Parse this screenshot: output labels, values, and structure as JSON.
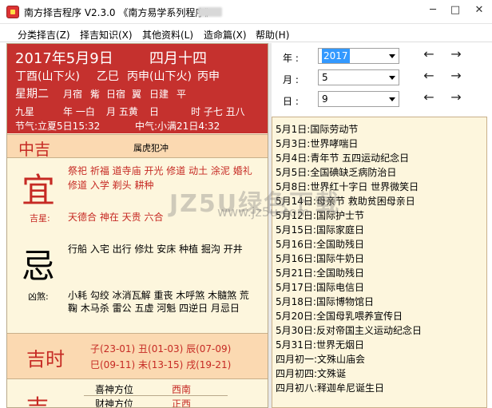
{
  "window": {
    "title": "南方择吉程序 V2.3.0  《南方易学系列程序》",
    "min": "─",
    "max": "□",
    "close": "✕"
  },
  "menu": [
    "分类择吉(Z)",
    "择吉知识(X)",
    "其他资料(L)",
    "造命篇(X)",
    "帮助(H)"
  ],
  "info": {
    "date": "2017年5月9日",
    "lunar": "四月十四",
    "year_gz": "丁酉(山下火)",
    "month_gz": "乙巳",
    "day_gz": "丙申(山下火)",
    "hour_gz": "丙申",
    "weekday": "星期二",
    "items": [
      "月宿",
      "觜",
      "日宿",
      "翼",
      "日建",
      "平"
    ],
    "jiuxing_label": "九星",
    "year_star": "年 一白",
    "month_star": "月 五黄",
    "day_star": "日",
    "hour_star": "时 子七 丑八",
    "jieqi1": "节气:立夏5日15:32",
    "jieqi2": "中气:小满21日4:32"
  },
  "zhongji": {
    "label": "中吉",
    "chong": "属虎犯冲"
  },
  "yi": {
    "char": "宜",
    "line1": "祭祀 祈福 道寺庙 开光 修道 动土 涂泥 婚礼",
    "line2": "修道 入学 剃头 耕种",
    "jixing_label": "吉星:",
    "jixing": "天德合 神在 天贵 六合"
  },
  "ji": {
    "char": "忌",
    "line1": "行船 入宅 出行 修灶 安床 种植 掘沟 开井",
    "xiongsha_label": "凶煞:",
    "xiong1": "小耗 勾绞 冰消瓦解 重丧 木呼煞 木髓煞 荒",
    "xiong2": "鞠 木马杀 雷公 五虚 河魁 四逆日 月忌日"
  },
  "jishi": {
    "label": "吉时",
    "row1": "子(23-01) 丑(01-03) 辰(07-09)",
    "row2": "巳(09-11) 未(13-15) 戌(19-21)"
  },
  "bottom": {
    "xishen_label": "喜神方位",
    "xishen": "西南",
    "caishen_label": "财神方位",
    "caishen": "正西",
    "big_char": "吉"
  },
  "selector": {
    "year_label": "年 :",
    "year_value": "2017",
    "month_label": "月 :",
    "month_value": "5",
    "day_label": "日 :",
    "day_value": "9",
    "prev": "←",
    "next": "→"
  },
  "holidays": [
    "5月1日:国际劳动节",
    "5月3日:世界哮喘日",
    "5月4日:青年节 五四运动纪念日",
    "5月5日:全国碘缺乏病防治日",
    "5月8日:世界红十字日 世界微笑日",
    "5月14日:母亲节 救助贫困母亲日",
    "5月12日:国际护士节",
    "5月15日:国际家庭日",
    "5月16日:全国助残日",
    "5月16日:国际牛奶日",
    "5月21日:全国助残日",
    "5月17日:国际电信日",
    "5月18日:国际博物馆日",
    "5月20日:全国母乳喂养宣传日",
    "5月30日:反对帝国主义运动纪念日",
    "5月31日:世界无烟日",
    "四月初一:文殊山庙会",
    "四月初四:文殊诞",
    "四月初八:释迦牟尼诞生日"
  ],
  "watermark": {
    "main": "JZ5U绿色下载",
    "sub": "www.jz5u.com"
  },
  "colors": {
    "header_red": "#c5312e",
    "accent_red": "#c62a24",
    "cream": "#fdf6dd",
    "band": "#fbd9b1"
  }
}
